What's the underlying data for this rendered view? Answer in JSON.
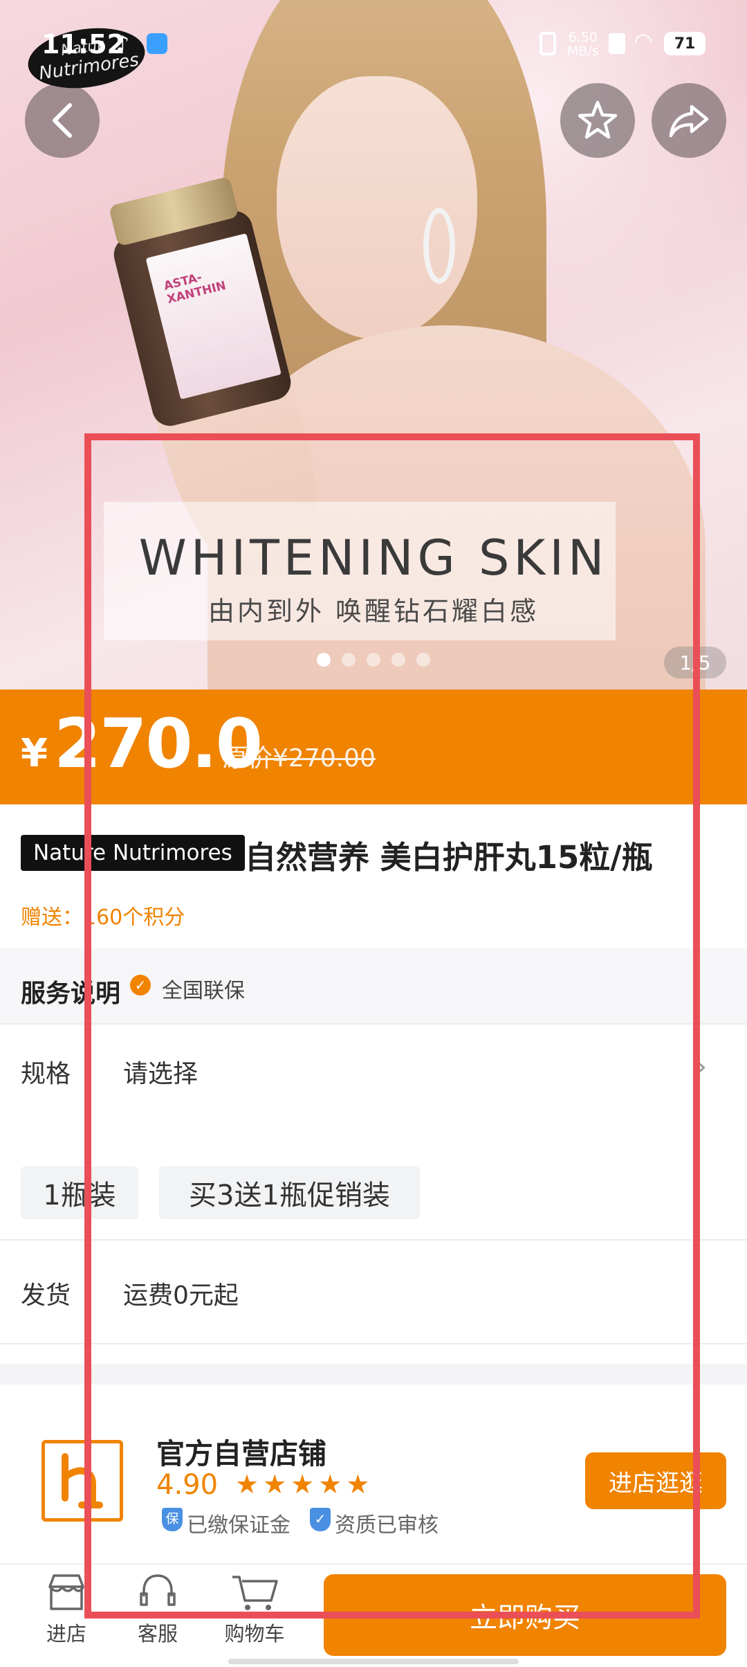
{
  "status": {
    "time": "11:52",
    "net_speed": "6.50",
    "net_unit": "MB/s",
    "battery": "71"
  },
  "hero": {
    "brand_line1": "Natur",
    "brand_line2": "Nutrimores",
    "bottle_label": "ASTA-XANTHIN",
    "headline": "WHITENING  SKIN",
    "subline": "由内到外 唤醒钻石耀白感",
    "page_counter": "1/5",
    "dots_total": 5,
    "dots_active": 1
  },
  "price": {
    "currency": "¥",
    "amount": "270.0",
    "original_label": "原价¥270.00"
  },
  "product": {
    "brand_tag": "Nature Nutrimores",
    "title": "自然营养 美白护肝丸15粒/瓶",
    "gift": "赠送：160个积分"
  },
  "service": {
    "label": "服务说明",
    "item": "全国联保"
  },
  "spec": {
    "label": "规格",
    "value": "请选择",
    "options": [
      "1瓶装",
      "买3送1瓶促销装"
    ]
  },
  "shipping": {
    "label": "发货",
    "value": "运费0元起"
  },
  "shop": {
    "name": "官方自营店铺",
    "rating": "4.90",
    "stars": 5,
    "badge1": "已缴保证金",
    "badge2": "资质已审核",
    "badge1_icon": "保",
    "enter_button": "进店逛逛"
  },
  "bottom_nav": {
    "store": "进店",
    "service": "客服",
    "cart": "购物车",
    "buy": "立即购买"
  },
  "colors": {
    "accent": "#f08300",
    "annotation": "#ea4f57"
  }
}
